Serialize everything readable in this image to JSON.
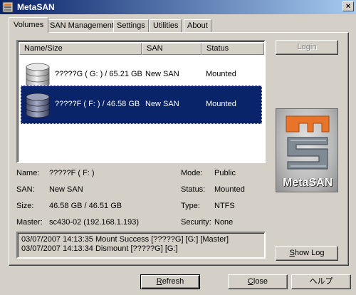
{
  "window": {
    "title": "MetaSAN",
    "close_glyph": "×"
  },
  "tabs": [
    {
      "label": "Volumes",
      "active": true
    },
    {
      "label": "SAN Management",
      "active": false
    },
    {
      "label": "Settings",
      "active": false
    },
    {
      "label": "Utilities",
      "active": false
    },
    {
      "label": "About",
      "active": false
    }
  ],
  "volumes": {
    "columns": [
      "Name/Size",
      "SAN",
      "Status"
    ],
    "rows": [
      {
        "icon": "disk-drive-icon",
        "name_size": "?????G ( G: ) / 65.21 GB",
        "san": "New SAN",
        "status": "Mounted",
        "selected": false
      },
      {
        "icon": "disk-drive-icon",
        "name_size": "?????F ( F: ) / 46.58 GB",
        "san": "New SAN",
        "status": "Mounted",
        "selected": true
      }
    ]
  },
  "login_button": "Login",
  "logo": {
    "text": "MetaSAN",
    "accent_color": "#e8742a"
  },
  "details": {
    "name_label": "Name:",
    "name_value": "?????F ( F: )",
    "san_label": "SAN:",
    "san_value": "New SAN",
    "size_label": "Size:",
    "size_value": "46.58 GB / 46.51 GB",
    "master_label": "Master:",
    "master_value": "sc430-02 (192.168.1.193)",
    "mode_label": "Mode:",
    "mode_value": "Public",
    "status_label": "Status:",
    "status_value": "Mounted",
    "type_label": "Type:",
    "type_value": "NTFS",
    "security_label": "Security:",
    "security_value": "None"
  },
  "log": {
    "lines": [
      "03/07/2007 14:13:35 Mount Success [?????G] [G:] [Master]",
      "03/07/2007 14:13:34 Dismount [?????G] [G:]"
    ]
  },
  "show_log_button": {
    "pre": "",
    "mnemonic": "S",
    "post": "how Log"
  },
  "footer": {
    "refresh": {
      "pre": "",
      "mnemonic": "R",
      "post": "efresh"
    },
    "close": {
      "pre": "",
      "mnemonic": "C",
      "post": "lose"
    },
    "help": "ヘルプ"
  }
}
